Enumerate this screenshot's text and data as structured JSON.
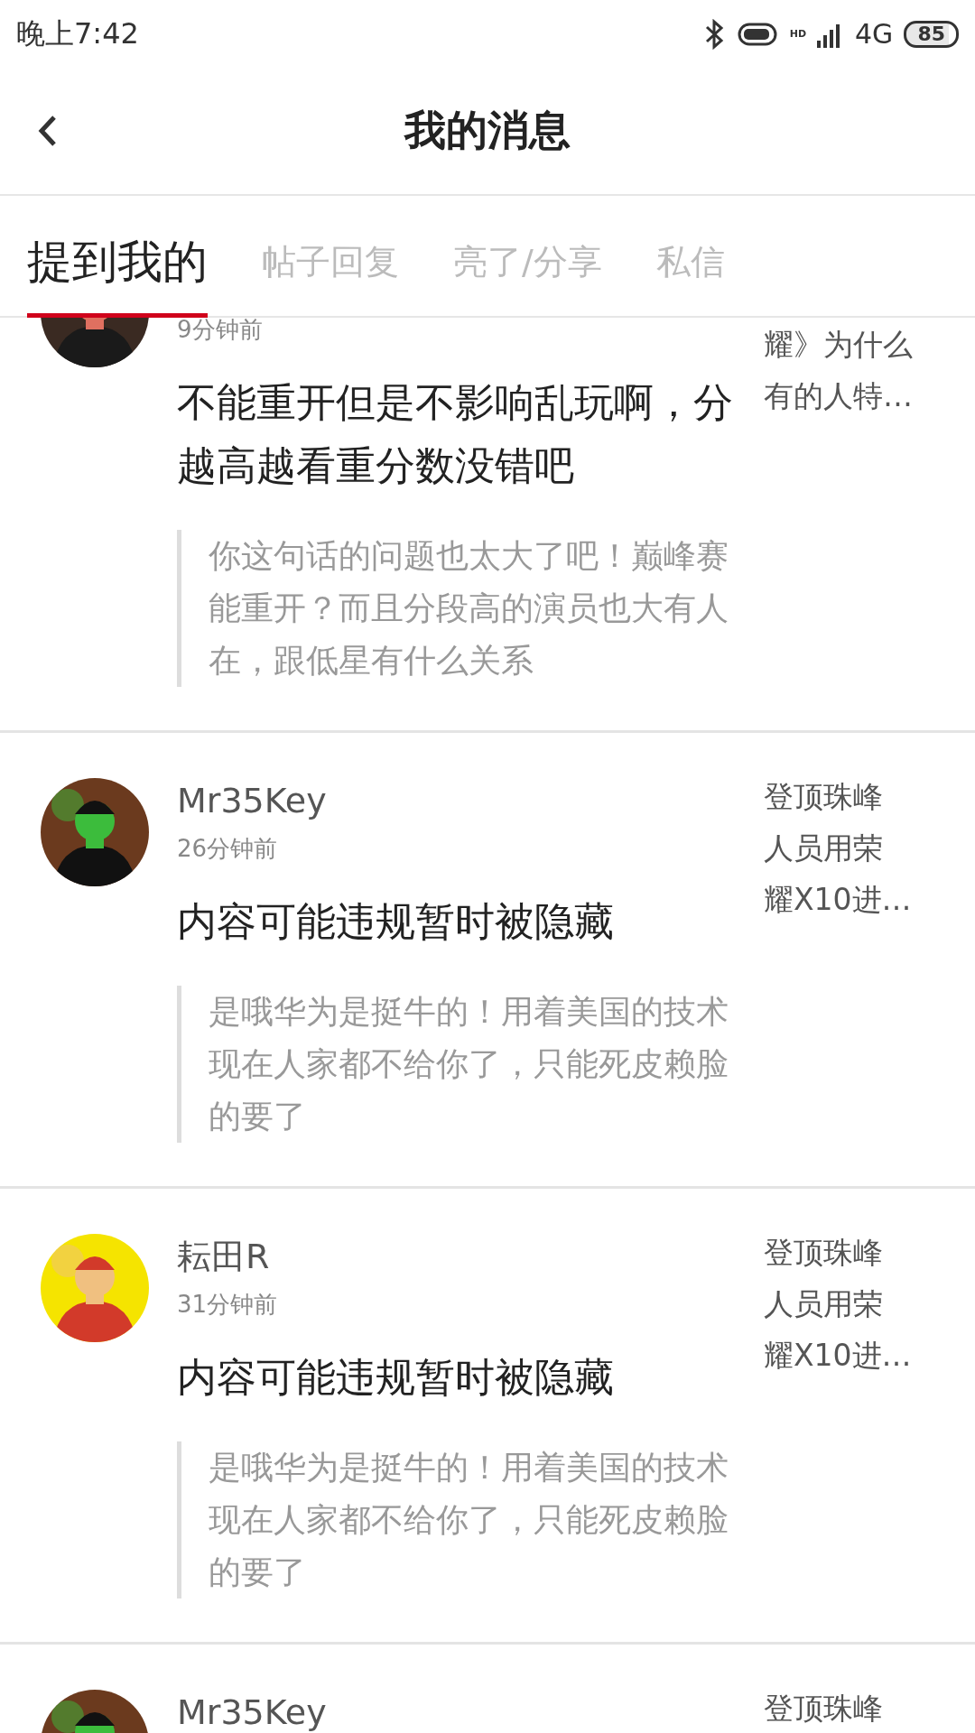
{
  "status_bar": {
    "time": "晚上7:42",
    "network_badge": "HD",
    "network": "4G",
    "battery": "85"
  },
  "header": {
    "title": "我的消息"
  },
  "tabs": [
    {
      "label": "提到我的",
      "selected": true
    },
    {
      "label": "帖子回复",
      "selected": false
    },
    {
      "label": "亮了/分享",
      "selected": false
    },
    {
      "label": "私信",
      "selected": false
    }
  ],
  "messages": [
    {
      "avatar": {
        "kind": "picture"
      },
      "time": "9分钟前",
      "text": "不能重开但是不影响乱玩啊，分越高越看重分数没错吧",
      "quote": "你这句话的问题也太大了吧！巅峰赛能重开？而且分段高的演员也大有人在，跟低星有什么关系",
      "topic": [
        "耀》为什么",
        "有的人特…"
      ]
    },
    {
      "avatar": {
        "kind": "picture"
      },
      "name": "Mr35Key",
      "time": "26分钟前",
      "text": "内容可能违规暂时被隐藏",
      "quote": "是哦华为是挺牛的！用着美国的技术现在人家都不给你了，只能死皮赖脸的要了",
      "topic": [
        "登顶珠峰",
        "人员用荣",
        "耀X10进…"
      ]
    },
    {
      "avatar": {
        "kind": "picture"
      },
      "name": "耘田R",
      "time": "31分钟前",
      "text": "内容可能违规暂时被隐藏",
      "quote": "是哦华为是挺牛的！用着美国的技术现在人家都不给你了，只能死皮赖脸的要了",
      "topic": [
        "登顶珠峰",
        "人员用荣",
        "耀X10进…"
      ]
    },
    {
      "avatar": {
        "kind": "picture"
      },
      "name": "Mr35Key",
      "topic": [
        "登顶珠峰"
      ]
    }
  ]
}
